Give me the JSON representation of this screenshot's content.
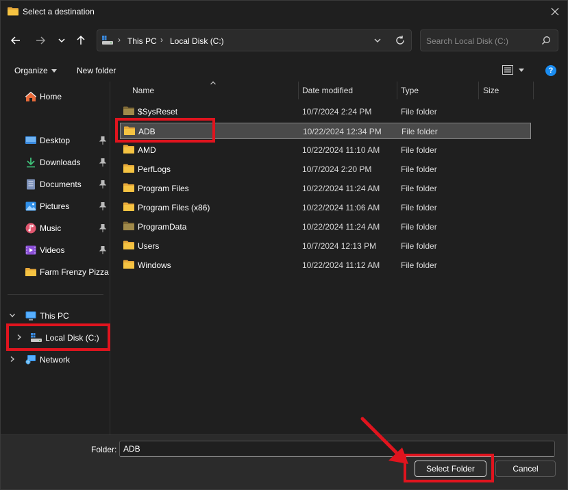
{
  "window": {
    "title": "Select a destination"
  },
  "address": {
    "crumbs": [
      "This PC",
      "Local Disk (C:)"
    ]
  },
  "search": {
    "placeholder": "Search Local Disk (C:)"
  },
  "commandbar": {
    "organize": "Organize",
    "new_folder": "New folder",
    "help": "?"
  },
  "sidebar": {
    "quick": [
      {
        "label": "Home",
        "icon": "home-icon"
      },
      {
        "label": "Desktop",
        "icon": "desktop-icon",
        "pinned": true
      },
      {
        "label": "Downloads",
        "icon": "downloads-icon",
        "pinned": true
      },
      {
        "label": "Documents",
        "icon": "documents-icon",
        "pinned": true
      },
      {
        "label": "Pictures",
        "icon": "pictures-icon",
        "pinned": true
      },
      {
        "label": "Music",
        "icon": "music-icon",
        "pinned": true
      },
      {
        "label": "Videos",
        "icon": "videos-icon",
        "pinned": true
      },
      {
        "label": "Farm Frenzy Pizza P",
        "icon": "folder-icon"
      }
    ],
    "tree": [
      {
        "label": "This PC",
        "icon": "monitor-icon",
        "expanded": true
      },
      {
        "label": "Local Disk (C:)",
        "icon": "drive-icon",
        "expanded": false
      },
      {
        "label": "Network",
        "icon": "network-icon",
        "expanded": false
      }
    ]
  },
  "columns": {
    "name": "Name",
    "date": "Date modified",
    "type": "Type",
    "size": "Size"
  },
  "files": [
    {
      "name": "$SysReset",
      "date": "10/7/2024 2:24 PM",
      "type": "File folder",
      "hidden": true
    },
    {
      "name": "ADB",
      "date": "10/22/2024 12:34 PM",
      "type": "File folder",
      "selected": true
    },
    {
      "name": "AMD",
      "date": "10/22/2024 11:10 AM",
      "type": "File folder"
    },
    {
      "name": "PerfLogs",
      "date": "10/7/2024 2:20 PM",
      "type": "File folder"
    },
    {
      "name": "Program Files",
      "date": "10/22/2024 11:24 AM",
      "type": "File folder"
    },
    {
      "name": "Program Files (x86)",
      "date": "10/22/2024 11:06 AM",
      "type": "File folder"
    },
    {
      "name": "ProgramData",
      "date": "10/22/2024 11:24 AM",
      "type": "File folder",
      "hidden": true
    },
    {
      "name": "Users",
      "date": "10/7/2024 12:13 PM",
      "type": "File folder"
    },
    {
      "name": "Windows",
      "date": "10/22/2024 11:12 AM",
      "type": "File folder"
    }
  ],
  "footer": {
    "folder_label": "Folder:",
    "folder_value": "ADB",
    "select_button": "Select Folder",
    "cancel_button": "Cancel"
  },
  "colors": {
    "folder": "#f5c342",
    "folder_hidden": "#a08a4a",
    "annotation": "#e0141e",
    "accent": "#1a8cf0"
  }
}
